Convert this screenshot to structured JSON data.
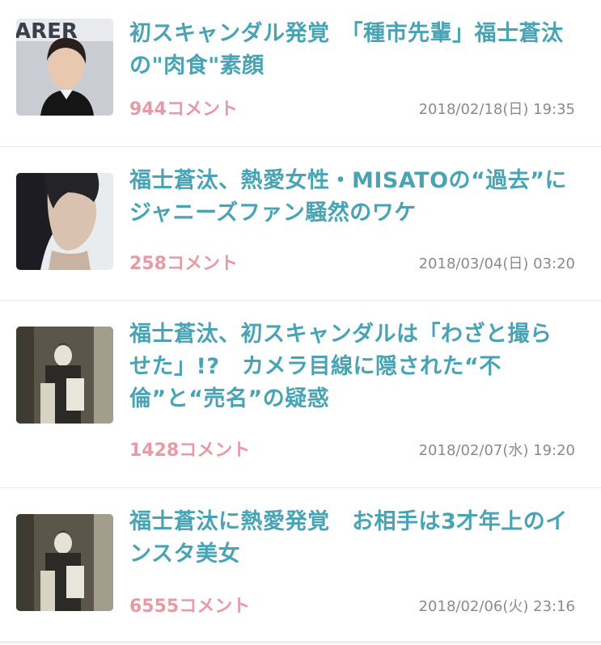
{
  "articles": [
    {
      "title": "初スキャンダル発覚　「種市先輩」福士蒼汰の\"肉食\"素顔",
      "comment_count": "944",
      "comment_label": "コメント",
      "datetime": "2018/02/18(日) 19:35",
      "thumbnail_icon": "person-photo-icon"
    },
    {
      "title": "福士蒼汰、熱愛女性・MISATOの“過去”にジャニーズファン騒然のワケ",
      "comment_count": "258",
      "comment_label": "コメント",
      "datetime": "2018/03/04(日) 03:20",
      "thumbnail_icon": "person-photo-icon"
    },
    {
      "title": "福士蒼汰、初スキャンダルは「わざと撮らせた」!?　カメラ目線に隠された“不倫”と“売名”の疑惑",
      "comment_count": "1428",
      "comment_label": "コメント",
      "datetime": "2018/02/07(水) 19:20",
      "thumbnail_icon": "doorway-photo-icon"
    },
    {
      "title": "福士蒼汰に熱愛発覚　お相手は3才年上のインスタ美女",
      "comment_count": "6555",
      "comment_label": "コメント",
      "datetime": "2018/02/06(火) 23:16",
      "thumbnail_icon": "doorway-photo-icon"
    }
  ]
}
